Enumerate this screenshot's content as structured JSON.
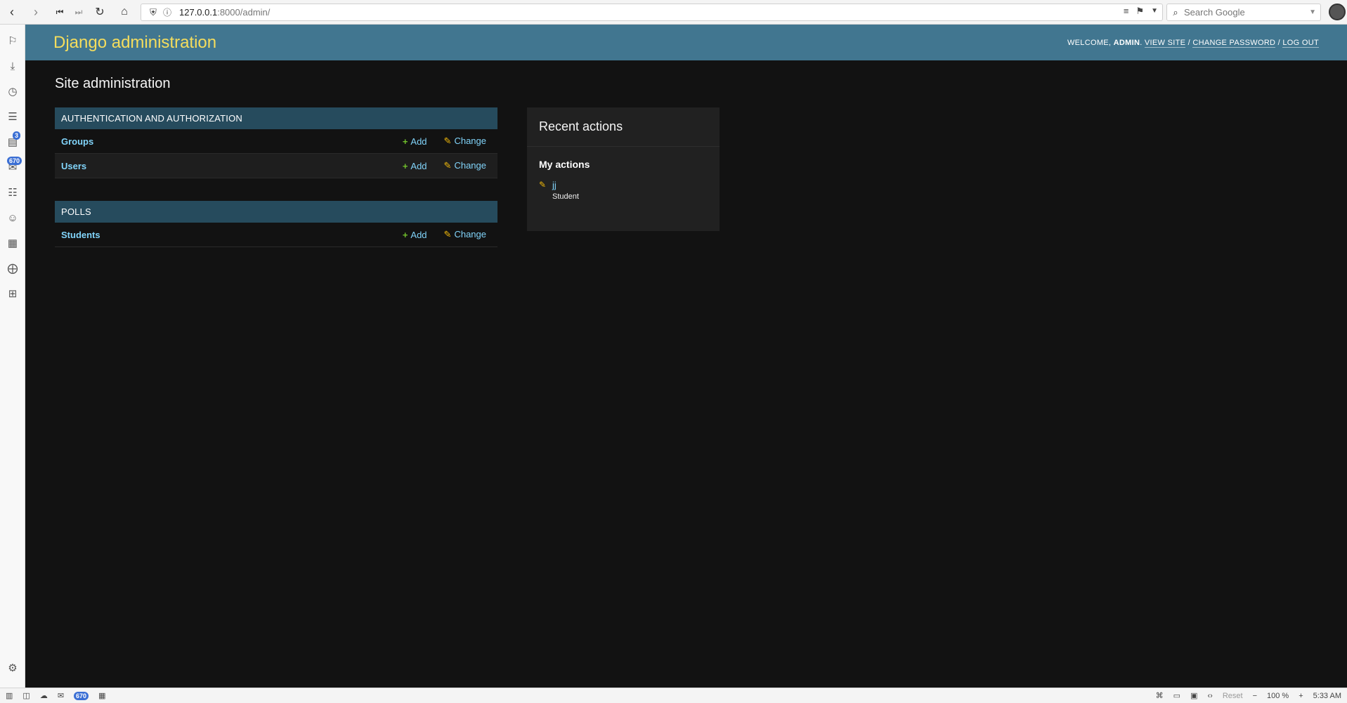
{
  "browser": {
    "url_host": "127.0.0.1",
    "url_rest": ":8000/admin/",
    "search_placeholder": "Search Google",
    "sidebar_badges": {
      "mail_count": "3",
      "feeds_count": "670"
    },
    "status": {
      "mail_count": "670",
      "reset_label": "Reset",
      "zoom": "100 %",
      "time": "5:33 AM"
    }
  },
  "header": {
    "brand": "Django administration",
    "welcome": "Welcome,",
    "user": "admin",
    "view_site": "View site",
    "change_password": "Change password",
    "log_out": "Log out"
  },
  "page_title": "Site administration",
  "apps": [
    {
      "name": "Authentication and Authorization",
      "models": [
        {
          "name": "Groups",
          "add": "Add",
          "change": "Change"
        },
        {
          "name": "Users",
          "add": "Add",
          "change": "Change"
        }
      ]
    },
    {
      "name": "Polls",
      "models": [
        {
          "name": "Students",
          "add": "Add",
          "change": "Change"
        }
      ]
    }
  ],
  "recent": {
    "title": "Recent actions",
    "subtitle": "My actions",
    "actions": [
      {
        "object": "jj",
        "type": "Student"
      }
    ]
  }
}
